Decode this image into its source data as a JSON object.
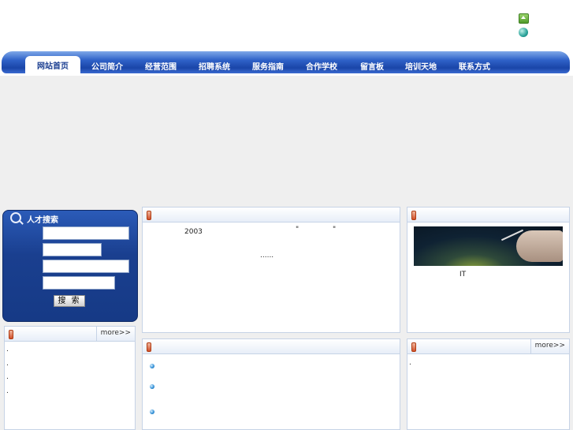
{
  "nav": {
    "items": [
      {
        "label": "网站首页",
        "active": true
      },
      {
        "label": "公司简介"
      },
      {
        "label": "经营范围"
      },
      {
        "label": "招聘系统"
      },
      {
        "label": "服务指南"
      },
      {
        "label": "合作学校"
      },
      {
        "label": "留言板"
      },
      {
        "label": "培训天地"
      },
      {
        "label": "联系方式"
      }
    ]
  },
  "search": {
    "title": "人才搜索",
    "button_label": "搜 索"
  },
  "intro": {
    "year": "2003",
    "dot1": "\"",
    "dot2": "\"",
    "ellipsis": "......"
  },
  "right_top": {
    "caption": "IT"
  },
  "more_label": "more>>",
  "left_list": {
    "dots": [
      ".",
      ".",
      ".",
      "."
    ]
  },
  "right_list": {
    "dots": [
      "."
    ]
  },
  "colors": {
    "nav_blue": "#1a45a8",
    "panel_border": "#c6d3e6",
    "search_blue": "#1a3f8f"
  }
}
